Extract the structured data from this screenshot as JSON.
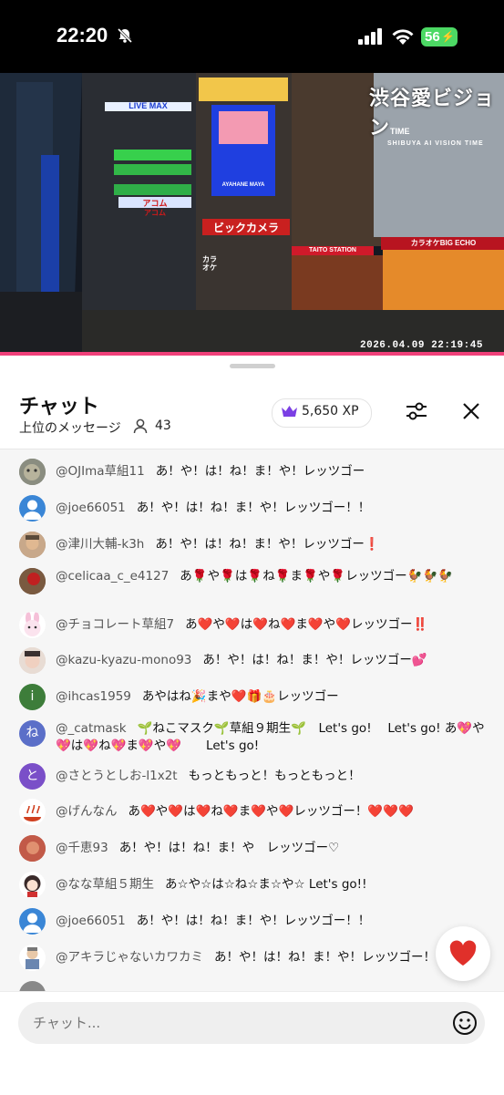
{
  "status_bar": {
    "time": "22:20",
    "battery": "56"
  },
  "video": {
    "logo": "渋谷愛ビジョン",
    "logo_suffix": "TIME",
    "logo_sub": "SHIBUYA AI VISION TIME",
    "timestamp": "2026.04.09 22:19:45",
    "signs": {
      "livemax": "LIVE MAX",
      "acom1": "アコム",
      "acom2": "アコム",
      "biccamera": "ビックカメラ",
      "karaoke": "カラオケ",
      "taito": "TAITO STATION",
      "karaoke_bigecho": "カラオケBIG ECHO",
      "screen_text": "AYAHANE MAYA"
    }
  },
  "header": {
    "title": "チャット",
    "subtitle": "上位のメッセージ",
    "viewers": "43",
    "xp": "5,650 XP"
  },
  "messages": [
    {
      "user": "@OJIma草組11",
      "text": "あ！や！は！ね！ま！や！レッツゴー"
    },
    {
      "user": "@joe66051",
      "text": "あ！や！は！ね！ま！や！レッツゴー！！"
    },
    {
      "user": "@津川大輔-k3h",
      "text": "あ！や！は！ね！ま！や！レッツゴー❗"
    },
    {
      "user": "@celicaa_c_e4127",
      "text": "あ🌹や🌹は🌹ね🌹ま🌹や🌹レッツゴー🐓🐓🐓"
    },
    {
      "user": "@チョコレート草組7",
      "text": "あ❤️や❤️は❤️ね❤️ま❤️や❤️レッツゴー‼️"
    },
    {
      "user": "@kazu-kyazu-mono93",
      "text": "あ！や！は！ね！ま！や！レッツゴー💕"
    },
    {
      "user": "@ihcas1959",
      "text": "あやはね🎉まや❤️🎁🎂レッツゴー"
    },
    {
      "user": "@_catmask",
      "text": "🌱ねこマスク🌱草組９期生🌱　Let's go!　 Let's go! あ💖や💖は💖ね💖ま💖や💖　　Let's go!"
    },
    {
      "user": "@さとうとしお-l1x2t",
      "text": "もっともっと！もっともっと！"
    },
    {
      "user": "@げんなん",
      "text": "あ❤️や❤️は❤️ね❤️ま❤️や❤️レッツゴー！❤️❤️❤️"
    },
    {
      "user": "@千恵93",
      "text": "あ！や！は！ね！ま！や　レッツゴー♡"
    },
    {
      "user": "@なな草組５期生",
      "text": "あ☆や☆は☆ね☆ま☆や☆ Let's go!!"
    },
    {
      "user": "@joe66051",
      "text": "あ！や！は！ね！ま！や！レッツゴー！！"
    },
    {
      "user": "@アキラじゃないカワカミ",
      "text": "あ！や！は！ね！ま！や！レッツゴー！"
    }
  ],
  "avatars": [
    "",
    "",
    "",
    "",
    "",
    "",
    "i",
    "ね",
    "と",
    "",
    "",
    "",
    "",
    ""
  ],
  "input": {
    "placeholder": "チャット..."
  },
  "colors": {
    "accent": "#f0407a",
    "heart": "#e0302a",
    "crown": "#7b3fe4"
  }
}
